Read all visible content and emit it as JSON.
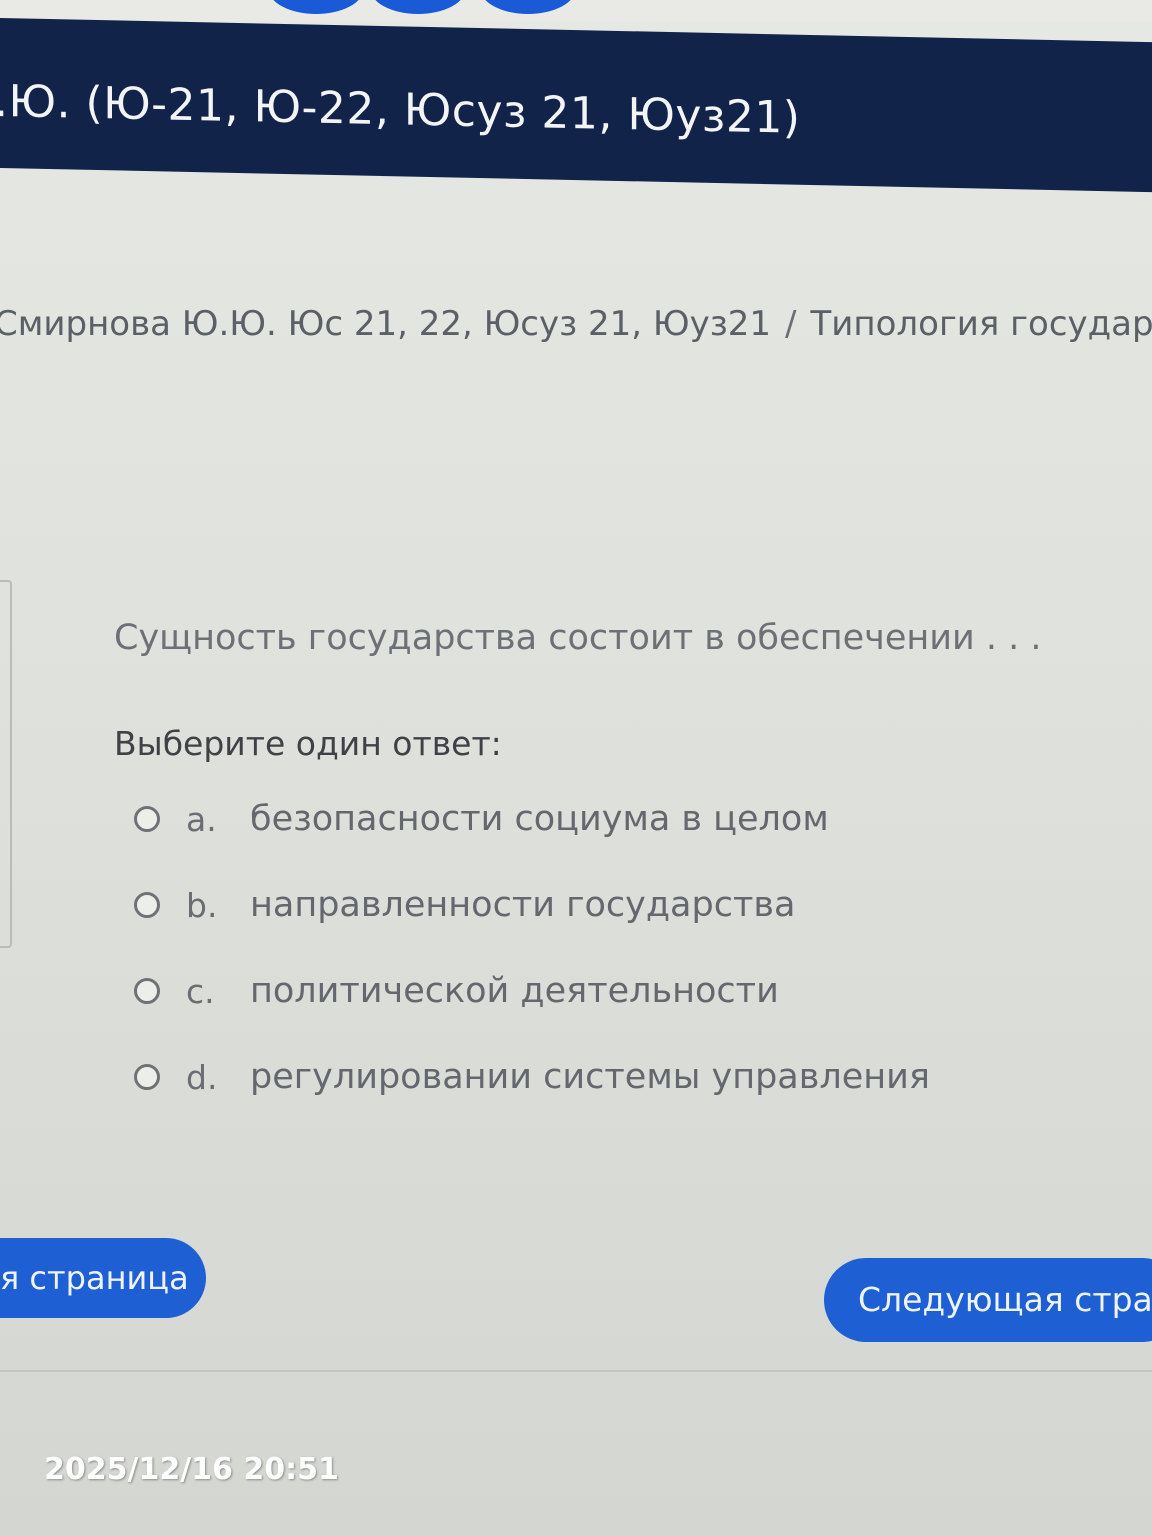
{
  "header": {
    "title": ".Ю. (Ю-21, Ю-22, Юсуз 21, Юуз21)"
  },
  "breadcrumb": {
    "course": "Смирнова Ю.Ю. Юс 21, 22, Юсуз 21, Юуз21",
    "separator": "/",
    "section": "Типология государ"
  },
  "question": {
    "text": "Сущность государства состоит в обеспечении . . .",
    "prompt": "Выберите один ответ:",
    "options": [
      {
        "letter": "a.",
        "text": "безопасности социума в целом"
      },
      {
        "letter": "b.",
        "text": "направленности государства"
      },
      {
        "letter": "c.",
        "text": "политической деятельности"
      },
      {
        "letter": "d.",
        "text": "регулировании системы управления"
      }
    ]
  },
  "navigation": {
    "prev_label": "я страница",
    "next_label": "Следующая стра"
  },
  "photo_timestamp": "2025/12/16 20:51",
  "colors": {
    "header_bg": "#12234a",
    "button_bg": "#1f5fd4"
  }
}
